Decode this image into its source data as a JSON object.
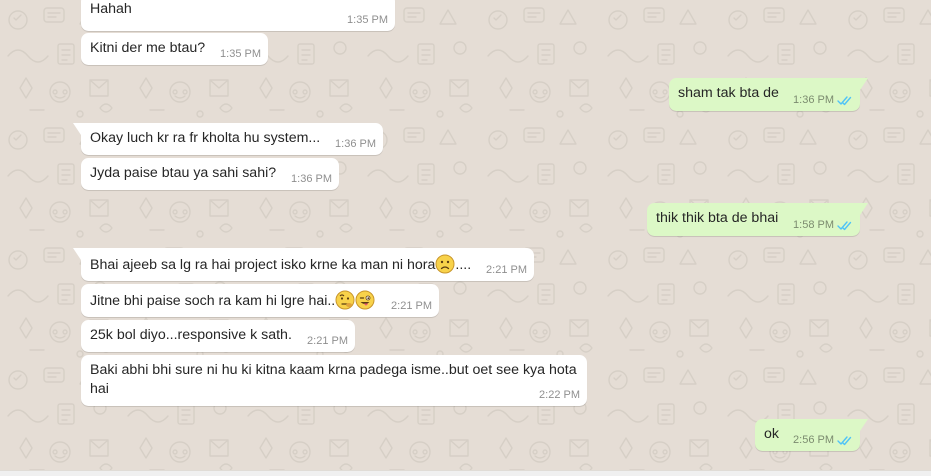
{
  "colors": {
    "chat_background": "#e5ddd5",
    "incoming_bubble": "#ffffff",
    "outgoing_bubble": "#dcf8c6",
    "read_ticks": "#4fc3f7"
  },
  "messages": [
    {
      "direction": "in",
      "text": "Hahah",
      "time": "1:35 PM"
    },
    {
      "direction": "in",
      "text": "Kitni der me btau?",
      "time": "1:35 PM"
    },
    {
      "direction": "out",
      "text": "sham tak bta de",
      "time": "1:36 PM",
      "status_icon": "double-check-read-icon"
    },
    {
      "direction": "in",
      "text": "Okay luch kr ra fr kholta hu system...",
      "time": "1:36 PM"
    },
    {
      "direction": "in",
      "text": "Jyda paise btau ya sahi sahi?",
      "time": "1:36 PM"
    },
    {
      "direction": "out",
      "text": "thik thik bta de bhai",
      "time": "1:58 PM",
      "status_icon": "double-check-read-icon"
    },
    {
      "direction": "in",
      "text_before_emoji": "Bhai ajeeb sa lg ra hai project isko krne ka man ni hora",
      "emoji_icons": [
        "slightly-frowning-face-emoji-icon"
      ],
      "text_after_emoji": "....",
      "time": "2:21 PM"
    },
    {
      "direction": "in",
      "text_before_emoji": "Jitne bhi paise soch ra kam hi lgre hai..",
      "emoji_icons": [
        "face-with-raised-eyebrow-emoji-icon",
        "winking-face-with-tongue-emoji-icon"
      ],
      "time": "2:21 PM"
    },
    {
      "direction": "in",
      "text": "25k bol diyo...responsive k sath.",
      "time": "2:21 PM"
    },
    {
      "direction": "in",
      "text": "Baki abhi bhi sure ni hu ki kitna kaam krna padega isme..but oet see kya hota hai",
      "time": "2:22 PM"
    },
    {
      "direction": "out",
      "text": "ok",
      "time": "2:56 PM",
      "status_icon": "double-check-read-icon"
    }
  ]
}
